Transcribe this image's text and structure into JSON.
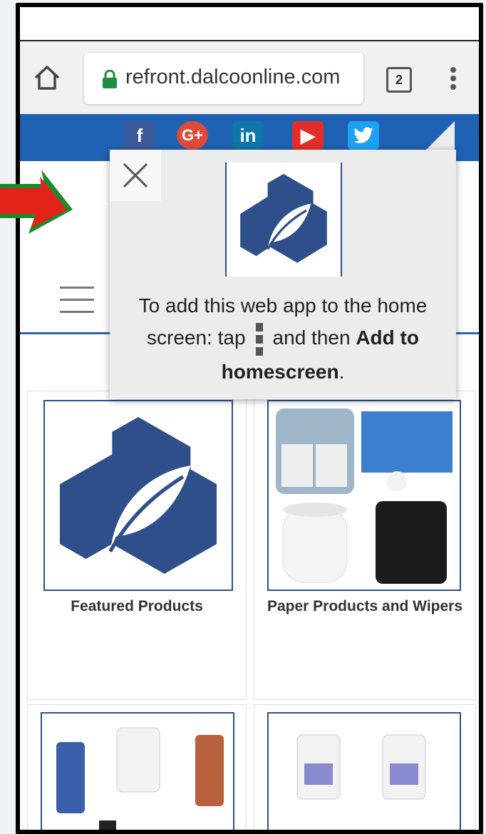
{
  "browser": {
    "url": "refront.dalcoonline.com",
    "tab_count": "2",
    "icons": [
      "home-icon",
      "lock-icon",
      "tabs-icon",
      "kebab-menu-icon"
    ]
  },
  "social": {
    "facebook": "f",
    "googleplus": "G+",
    "linkedin": "in",
    "youtube": "▶",
    "twitter": "🐦"
  },
  "popup": {
    "text_before": "To add this web app to the home screen: tap",
    "text_middle": "and then",
    "text_bold": "Add to homescreen",
    "text_end": "."
  },
  "categories": [
    {
      "label": "Featured Products"
    },
    {
      "label": "Paper Products and Wipers"
    }
  ],
  "colors": {
    "brand_blue": "#1f61b3",
    "logo_blue": "#2f4f8a",
    "arrow_red": "#e2231a",
    "arrow_green": "#1a8a2a"
  }
}
